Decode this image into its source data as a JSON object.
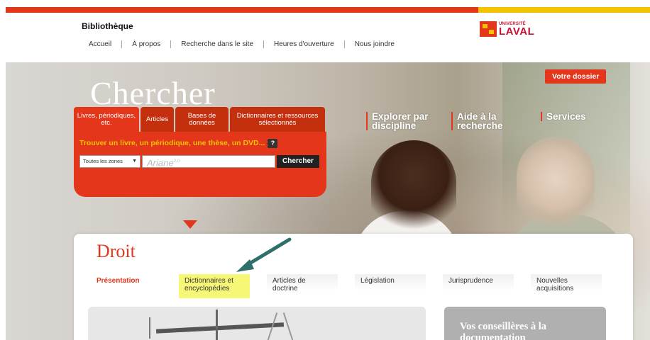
{
  "header": {
    "site_title": "Bibliothèque",
    "nav": [
      "Accueil",
      "À propos",
      "Recherche dans le site",
      "Heures d'ouverture",
      "Nous joindre"
    ],
    "logo": {
      "line1": "UNIVERSITÉ",
      "line2": "LAVAL"
    }
  },
  "colors": {
    "accent": "#e4361b",
    "accent_dark": "#c4300d",
    "yellow": "#f4c300",
    "highlight": "#f7f777",
    "arrow": "#2e6f6c"
  },
  "hero": {
    "title": "Chercher",
    "account_button": "Votre dossier",
    "quick_links": [
      "Explorer par discipline",
      "Aide à la recherche",
      "Services"
    ]
  },
  "search": {
    "tabs": [
      "Livres, périodiques, etc.",
      "Articles",
      "Bases de données",
      "Dictionnaires et ressources sélectionnés"
    ],
    "prompt": "Trouver un livre, un périodique, une thèse, un DVD...",
    "help_label": "?",
    "zone_select": "Toutes les zones",
    "input_logo": "Ariane",
    "input_logo_sup": "2.0",
    "submit_label": "Chercher"
  },
  "content": {
    "section_title": "Droit",
    "tabs": [
      "Présentation",
      "Dictionnaires et encyclopédies",
      "Articles de doctrine",
      "Législation",
      "Jurisprudence",
      "Nouvelles acquisitions"
    ],
    "active_tab": "Présentation",
    "highlighted_tab": "Dictionnaires et encyclopédies",
    "advisors_title": "Vos conseillères à la documentation"
  },
  "icons": {
    "help": "question-icon",
    "dropdown": "chevron-down-icon",
    "annotation": "arrow-icon",
    "scale": "scales-of-justice-icon"
  }
}
